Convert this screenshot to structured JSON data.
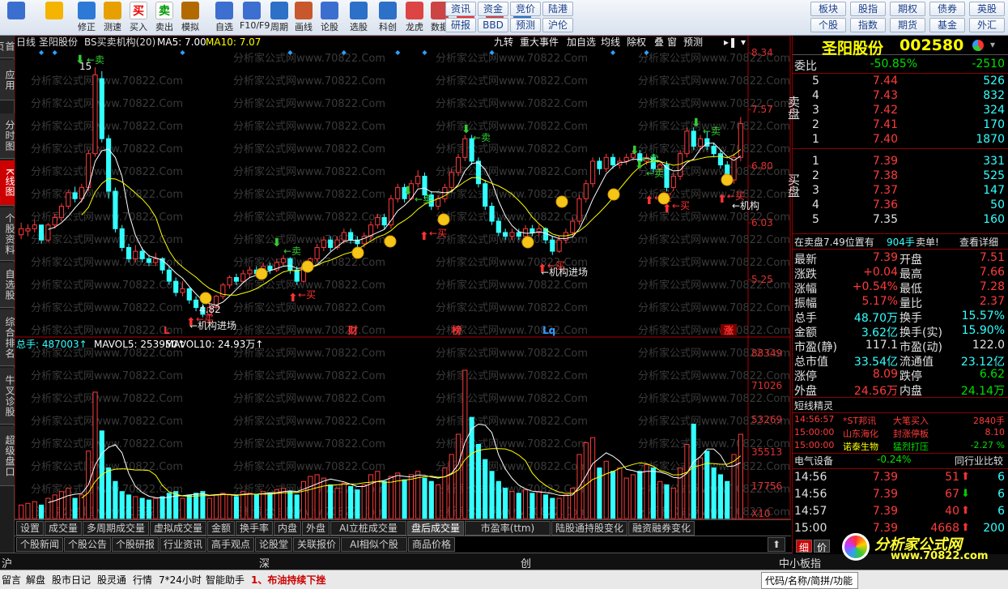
{
  "toolbar": {
    "buttons": [
      {
        "label": "",
        "icon": "windows-logo-icon"
      },
      {
        "label": "",
        "icon": "back-arrow-icon"
      },
      {
        "label": "修正",
        "icon": "arrow-updown-icon"
      },
      {
        "label": "测速",
        "icon": "speed-icon"
      },
      {
        "label": "买入",
        "icon": "buy-icon",
        "glyph": "买"
      },
      {
        "label": "卖出",
        "icon": "sell-icon",
        "glyph": "卖"
      },
      {
        "label": "模拟",
        "icon": "gavel-icon"
      },
      {
        "label": "自选",
        "icon": "star-icon"
      },
      {
        "label": "F10/F9",
        "icon": "f10-icon"
      },
      {
        "label": "周期",
        "icon": "cycle-icon"
      },
      {
        "label": "画线",
        "icon": "pencil-icon"
      },
      {
        "label": "论股",
        "icon": "talk-icon"
      },
      {
        "label": "选股",
        "icon": "select-stock-icon"
      },
      {
        "label": "科创",
        "icon": "chart-icon"
      },
      {
        "label": "龙虎",
        "icon": "dragon-tiger-icon"
      },
      {
        "label": "数据",
        "icon": "pe-icon"
      },
      {
        "label": "热点",
        "icon": "hot-icon"
      },
      {
        "label": "新股",
        "icon": "ipo-icon"
      },
      {
        "label": "全球",
        "icon": "globe-icon"
      }
    ],
    "text_buttons": [
      [
        "资讯",
        "资金",
        "竞价",
        "陆港"
      ],
      [
        "研报",
        "BBD",
        "预测",
        "沪伦"
      ],
      [
        "板块",
        "股指",
        "期权",
        "债券",
        "英股"
      ],
      [
        "个股",
        "指数",
        "期货",
        "基金",
        "外汇"
      ]
    ]
  },
  "leftnav": [
    "首页",
    "应用",
    "分时图",
    "K线图",
    "个股资料",
    "自选股",
    "综合排名",
    "牛叉诊股",
    "超级盘口"
  ],
  "chart_header": {
    "period": "日线",
    "name": "圣阳股份",
    "indicator": "BS买卖机构(20)",
    "ma5": "MA5: 7.00",
    "ma10": "MA10: 7.07",
    "buttons": [
      "九转",
      "重大事件",
      "加自选",
      "均线",
      "除权",
      "叠",
      "窗",
      "预测"
    ]
  },
  "watermark": "分析家公式网www.70822.Com",
  "price_axis": [
    "8.34",
    "7.57",
    "6.80",
    "6.03",
    "5.25"
  ],
  "volume_axis": [
    "88349",
    "71026",
    "53269",
    "35513",
    "17756",
    "X10"
  ],
  "volume_header": {
    "total": "总手: 487003",
    "mavol5": "MAVOL5: 253950",
    "mavol10": "MAVOL10: 24.93万"
  },
  "chart_data": {
    "type": "candlestick",
    "ylim": [
      4.6,
      8.4
    ],
    "volume_ylim": [
      0,
      88349
    ],
    "annotations": [
      "15",
      "4.82",
      "机构进场",
      "机构进场",
      "机构",
      "卖",
      "买",
      "L",
      "财",
      "榜",
      "Lq",
      "涨"
    ],
    "candles": [
      [
        5.92,
        6.0,
        6.08,
        5.86
      ],
      [
        5.97,
        6.0,
        6.06,
        5.9
      ],
      [
        6.0,
        6.05,
        6.12,
        5.95
      ],
      [
        6.05,
        5.85,
        6.05,
        5.8
      ],
      [
        5.85,
        6.05,
        6.08,
        5.82
      ],
      [
        6.05,
        6.15,
        6.2,
        6.0
      ],
      [
        6.15,
        6.3,
        6.34,
        6.1
      ],
      [
        6.3,
        6.48,
        6.52,
        6.26
      ],
      [
        6.48,
        6.4,
        6.56,
        6.35
      ],
      [
        6.4,
        6.55,
        6.6,
        6.35
      ],
      [
        6.55,
        7.0,
        7.05,
        6.5
      ],
      [
        7.0,
        8.05,
        8.15,
        6.96
      ],
      [
        8.0,
        7.2,
        8.1,
        7.15
      ],
      [
        7.2,
        6.5,
        7.25,
        6.4
      ],
      [
        6.5,
        6.0,
        6.55,
        5.95
      ],
      [
        6.0,
        5.75,
        6.05,
        5.7
      ],
      [
        5.75,
        5.6,
        5.8,
        5.55
      ],
      [
        5.6,
        5.7,
        5.78,
        5.55
      ],
      [
        5.7,
        5.6,
        5.75,
        5.55
      ],
      [
        5.6,
        5.55,
        5.65,
        5.5
      ],
      [
        5.55,
        5.6,
        5.68,
        5.5
      ],
      [
        5.6,
        5.45,
        5.62,
        5.4
      ],
      [
        5.45,
        5.3,
        5.5,
        5.25
      ],
      [
        5.3,
        5.15,
        5.35,
        5.1
      ],
      [
        5.15,
        5.2,
        5.3,
        5.1
      ],
      [
        5.2,
        5.05,
        5.22,
        5.0
      ],
      [
        5.05,
        4.95,
        5.1,
        4.9
      ],
      [
        4.95,
        4.86,
        5.0,
        4.82
      ],
      [
        4.86,
        4.95,
        5.0,
        4.82
      ],
      [
        4.95,
        5.1,
        5.12,
        4.92
      ],
      [
        5.1,
        5.25,
        5.28,
        5.06
      ],
      [
        5.25,
        5.35,
        5.38,
        5.2
      ],
      [
        5.35,
        5.3,
        5.4,
        5.25
      ],
      [
        5.3,
        5.4,
        5.45,
        5.28
      ],
      [
        5.4,
        5.45,
        5.5,
        5.35
      ],
      [
        5.45,
        5.4,
        5.5,
        5.35
      ],
      [
        5.4,
        5.5,
        5.55,
        5.36
      ],
      [
        5.5,
        5.45,
        5.55,
        5.4
      ],
      [
        5.45,
        5.55,
        5.6,
        5.42
      ],
      [
        5.55,
        5.6,
        5.65,
        5.5
      ],
      [
        5.6,
        5.45,
        5.62,
        5.4
      ],
      [
        5.45,
        5.3,
        5.5,
        5.25
      ],
      [
        5.3,
        5.5,
        5.55,
        5.28
      ],
      [
        5.5,
        5.6,
        5.62,
        5.45
      ],
      [
        5.6,
        5.75,
        5.8,
        5.55
      ],
      [
        5.75,
        5.85,
        5.9,
        5.7
      ],
      [
        5.85,
        5.75,
        5.9,
        5.7
      ],
      [
        5.75,
        5.85,
        5.9,
        5.72
      ],
      [
        5.85,
        5.95,
        6.0,
        5.8
      ],
      [
        5.95,
        5.85,
        6.0,
        5.8
      ],
      [
        5.85,
        5.8,
        5.9,
        5.75
      ],
      [
        5.8,
        5.9,
        5.95,
        5.75
      ],
      [
        5.9,
        6.05,
        6.1,
        5.85
      ],
      [
        6.05,
        6.15,
        6.2,
        6.0
      ],
      [
        6.15,
        6.05,
        6.2,
        6.0
      ],
      [
        6.05,
        6.4,
        6.45,
        6.0
      ],
      [
        6.4,
        6.55,
        6.6,
        6.35
      ],
      [
        6.55,
        6.4,
        6.6,
        6.35
      ],
      [
        6.4,
        6.6,
        6.65,
        6.38
      ],
      [
        6.6,
        6.7,
        6.78,
        6.55
      ],
      [
        6.7,
        6.45,
        6.75,
        6.4
      ],
      [
        6.45,
        6.3,
        6.5,
        6.25
      ],
      [
        6.3,
        6.4,
        6.45,
        6.25
      ],
      [
        6.4,
        6.55,
        6.6,
        6.35
      ],
      [
        6.55,
        6.75,
        6.8,
        6.5
      ],
      [
        6.75,
        6.95,
        7.0,
        6.7
      ],
      [
        6.95,
        7.2,
        7.25,
        6.9
      ],
      [
        7.2,
        6.9,
        7.25,
        6.85
      ],
      [
        6.9,
        6.6,
        6.95,
        6.55
      ],
      [
        6.6,
        6.3,
        6.65,
        6.25
      ],
      [
        6.3,
        6.1,
        6.35,
        6.05
      ],
      [
        6.1,
        5.95,
        6.15,
        5.9
      ],
      [
        5.95,
        5.9,
        6.0,
        5.85
      ],
      [
        5.9,
        5.95,
        6.0,
        5.85
      ],
      [
        5.95,
        5.9,
        6.0,
        5.85
      ],
      [
        5.9,
        6.0,
        6.05,
        5.85
      ],
      [
        6.0,
        5.95,
        6.05,
        5.9
      ],
      [
        5.95,
        6.0,
        6.05,
        5.9
      ],
      [
        6.0,
        5.85,
        6.02,
        5.8
      ],
      [
        5.85,
        5.7,
        5.9,
        5.65
      ],
      [
        5.7,
        5.85,
        5.9,
        5.68
      ],
      [
        5.85,
        5.95,
        6.0,
        5.8
      ],
      [
        5.95,
        6.1,
        6.15,
        5.9
      ],
      [
        6.1,
        6.4,
        6.45,
        6.05
      ],
      [
        6.4,
        6.6,
        6.65,
        6.35
      ],
      [
        6.6,
        6.9,
        6.95,
        6.55
      ],
      [
        6.9,
        6.8,
        6.95,
        6.72
      ],
      [
        6.8,
        6.95,
        7.0,
        6.75
      ],
      [
        6.95,
        6.85,
        7.0,
        6.8
      ],
      [
        6.85,
        6.9,
        6.95,
        6.8
      ],
      [
        6.9,
        6.95,
        7.0,
        6.85
      ],
      [
        6.95,
        7.0,
        7.05,
        6.9
      ],
      [
        7.0,
        6.9,
        7.05,
        6.85
      ],
      [
        6.9,
        6.95,
        7.0,
        6.85
      ],
      [
        6.95,
        6.8,
        7.0,
        6.75
      ],
      [
        6.8,
        6.85,
        6.9,
        6.75
      ],
      [
        6.85,
        6.55,
        6.9,
        6.5
      ],
      [
        6.55,
        6.7,
        6.75,
        6.5
      ],
      [
        6.7,
        7.0,
        7.05,
        6.65
      ],
      [
        7.0,
        7.3,
        7.35,
        6.95
      ],
      [
        7.3,
        7.1,
        7.35,
        7.05
      ],
      [
        7.1,
        7.2,
        7.25,
        7.05
      ],
      [
        7.2,
        7.1,
        7.3,
        7.05
      ],
      [
        7.1,
        7.0,
        7.15,
        6.95
      ],
      [
        7.0,
        6.85,
        7.05,
        6.8
      ],
      [
        6.85,
        6.65,
        6.9,
        6.6
      ],
      [
        6.65,
        6.95,
        7.0,
        6.6
      ],
      [
        6.95,
        7.4,
        7.49,
        6.9
      ]
    ],
    "volumes": [
      8,
      9,
      10,
      8,
      12,
      14,
      16,
      18,
      12,
      14,
      40,
      75,
      52,
      30,
      22,
      16,
      14,
      13,
      12,
      11,
      12,
      13,
      15,
      16,
      12,
      14,
      15,
      16,
      12,
      14,
      15,
      14,
      13,
      16,
      15,
      14,
      16,
      15,
      17,
      18,
      16,
      14,
      22,
      25,
      26,
      24,
      20,
      18,
      21,
      19,
      17,
      20,
      26,
      28,
      22,
      25,
      27,
      23,
      26,
      28,
      24,
      22,
      20,
      30,
      38,
      50,
      88,
      60,
      44,
      35,
      28,
      22,
      18,
      16,
      15,
      17,
      15,
      16,
      14,
      12,
      12,
      14,
      18,
      38,
      45,
      48,
      30,
      34,
      28,
      30,
      24,
      26,
      28,
      32,
      30,
      22,
      20,
      18,
      30,
      44,
      56,
      36,
      40,
      30,
      26,
      22,
      38,
      50
    ]
  },
  "bottom_tabs1": [
    "设置",
    "成交量",
    "多周期成交量",
    "虚拟成交量",
    "金额",
    "换手率",
    "内盘",
    "外盘",
    "AI立桩成交量",
    "盘后成交量",
    "市盈率(ttm)",
    "陆股通持股变化",
    "融资融券变化"
  ],
  "bottom_tabs2": [
    "个股新闻",
    "个股公告",
    "个股研报",
    "行业资讯",
    "高手观点",
    "论股堂",
    "关联报价",
    "AI相似个股",
    "商品价格"
  ],
  "market_bar": [
    "沪",
    "深",
    "创",
    "中小板指"
  ],
  "status_bar": [
    "留言",
    "解盘",
    "股市日记",
    "股灵通",
    "行情",
    "7*24小时",
    "智能助手",
    "1、布油持续下挫",
    "代码/名称/简拼/功能"
  ],
  "quote": {
    "title": "圣阳股份",
    "code": "002580",
    "weibi_label": "委比",
    "weibi": "-50.85%",
    "weicha": "-2510",
    "sell_label": "卖盘",
    "buy_label": "买盘",
    "asks": [
      [
        "5",
        "7.44",
        "526"
      ],
      [
        "4",
        "7.43",
        "832"
      ],
      [
        "3",
        "7.42",
        "324"
      ],
      [
        "2",
        "7.41",
        "170"
      ],
      [
        "1",
        "7.40",
        "1870"
      ]
    ],
    "bids": [
      [
        "1",
        "7.39",
        "331"
      ],
      [
        "2",
        "7.38",
        "525"
      ],
      [
        "3",
        "7.37",
        "147"
      ],
      [
        "4",
        "7.36",
        "50"
      ],
      [
        "5",
        "7.35",
        "160"
      ]
    ],
    "big_order": "在卖盘7.49位置有",
    "big_order_vol": "904手",
    "big_order_tag": "卖单!",
    "detail": "查看详细",
    "stats": [
      [
        "最新",
        "7.39",
        "开盘",
        "7.51"
      ],
      [
        "涨跌",
        "+0.04",
        "最高",
        "7.66"
      ],
      [
        "涨幅",
        "+0.54%",
        "最低",
        "7.28"
      ],
      [
        "振幅",
        "5.17%",
        "量比",
        "2.37"
      ],
      [
        "总手",
        "48.70万",
        "换手",
        "15.57%"
      ],
      [
        "金额",
        "3.62亿",
        "换手(实)",
        "15.90%"
      ],
      [
        "市盈(静)",
        "117.1",
        "市盈(动)",
        "122.0"
      ],
      [
        "总市值",
        "33.54亿",
        "流通值",
        "23.12亿"
      ],
      [
        "涨停",
        "8.09",
        "跌停",
        "6.62"
      ],
      [
        "外盘",
        "24.56万",
        "内盘",
        "24.14万"
      ]
    ],
    "short_title": "短线精灵",
    "short_list": [
      [
        "14:56:57",
        "*ST邦讯",
        "大笔买入",
        "2840手"
      ],
      [
        "15:00:00",
        "山东海化",
        "封涨停板",
        "8.10"
      ],
      [
        "15:00:00",
        "诺泰生物",
        "猛烈打压",
        "-2.27 %"
      ]
    ],
    "sector": "电气设备",
    "sector_chg": "-0.24%",
    "sector_cmp": "同行业比较",
    "ticks": [
      [
        "14:56",
        "7.39",
        "51",
        "6"
      ],
      [
        "14:56",
        "7.39",
        "67",
        "6"
      ],
      [
        "14:57",
        "7.39",
        "40",
        "6"
      ],
      [
        "15:00",
        "7.39",
        "4668",
        "200"
      ]
    ],
    "tabs": [
      "细",
      "价"
    ],
    "logo": "分析家公式网",
    "logo_url": "www.70822.com"
  },
  "colors": {
    "up": "#ff3b3b",
    "down": "#3ff",
    "ma5": "#ffffff",
    "ma10": "#ffff00",
    "bg": "#000000"
  }
}
